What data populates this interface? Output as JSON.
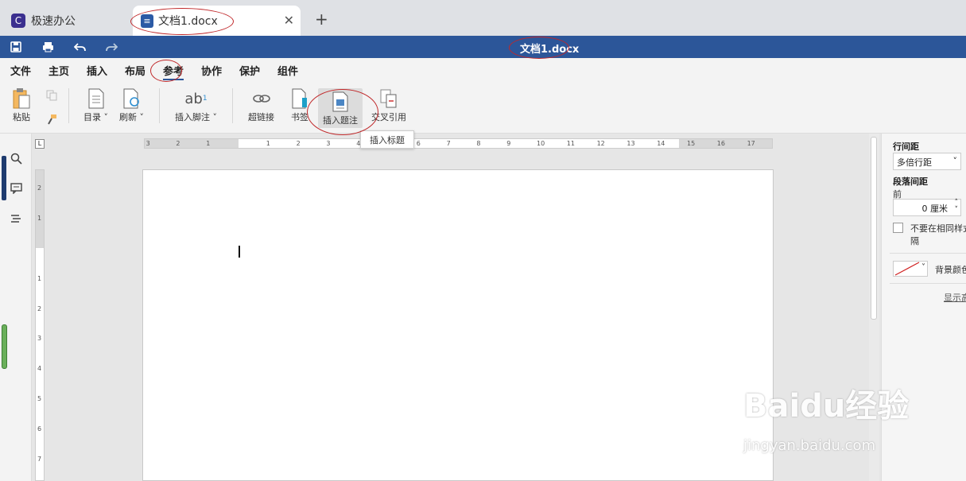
{
  "tabs": {
    "app_title": "极速办公",
    "doc_title": "文档1.docx",
    "close_symbol": "✕",
    "add_symbol": "+"
  },
  "titlebar": {
    "title": "文档1.docx"
  },
  "menu": {
    "items": [
      "文件",
      "主页",
      "插入",
      "布局",
      "参考",
      "协作",
      "保护",
      "组件"
    ],
    "active": "参考"
  },
  "ribbon": {
    "paste": "粘贴",
    "toc": "目录",
    "refresh": "刷新",
    "footnote": "插入脚注",
    "footnote_icon_text": "ab",
    "footnote_sup": "1",
    "hyperlink": "超链接",
    "bookmark": "书签",
    "caption": "插入题注",
    "cross_ref": "交叉引用"
  },
  "tooltip": {
    "text": "插入标题"
  },
  "ruler": {
    "h_labels": [
      "3",
      "2",
      "1",
      "1",
      "2",
      "3",
      "4",
      "5",
      "6",
      "7",
      "8",
      "9",
      "10",
      "11",
      "12",
      "13",
      "14",
      "15",
      "16",
      "17"
    ],
    "v_labels": [
      "2",
      "1",
      "1",
      "2",
      "3",
      "4",
      "5",
      "6",
      "7"
    ],
    "corner": "L"
  },
  "right_panel": {
    "line_spacing_label": "行间距",
    "line_spacing_value": "多倍行距",
    "para_spacing_label": "段落间距",
    "before_label": "前",
    "before_value": "0 厘米",
    "no_space_same_style": "不要在相同样式",
    "no_space_same_style_2": "隔",
    "bg_color_label": "背景颜色",
    "show_more": "显示高"
  },
  "watermark": {
    "text": "Baidu经验",
    "sub": "jingyan.baidu.com"
  },
  "colors": {
    "title_blue": "#2c5699",
    "annotation_red": "#c0282a"
  }
}
